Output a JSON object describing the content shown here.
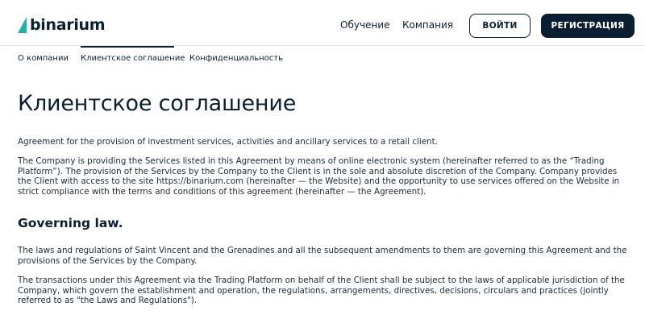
{
  "header": {
    "logo_text": "binarium",
    "nav": {
      "learn": "Обучение",
      "company": "Компания"
    },
    "login_label": "ВОЙТИ",
    "register_label": "РЕГИСТРАЦИЯ",
    "accent_color": "#1fb5a6",
    "dark_color": "#0b1f33"
  },
  "subnav": {
    "items": [
      {
        "label": "О компании",
        "active": false
      },
      {
        "label": "Клиентское соглашение",
        "active": true
      },
      {
        "label": "Конфиденциальность",
        "active": false
      }
    ]
  },
  "main": {
    "title": "Клиентское соглашение",
    "paragraphs": [
      "Agreement for the provision of investment services, activities and ancillary services to a retail client.",
      "The Company is providing the Services listed in this Agreement by means of online electronic system (hereinafter referred to as the “Trading Platform”). The provision of the Services by the Company to the Client is in the sole and absolute discretion of the Company. Company provides the Client with access to the site https://binarium.com (hereinafter — the Website) and the opportunity to use services offered on the Website in strict compliance with the terms and conditions of this agreement (hereinafter — the Agreement).",
      "The laws and regulations of Saint Vincent and the Grenadines and all the subsequent amendments to them are governing this Agreement and the provisions of the Services by the Company.",
      "The transactions under this Agreement via the Trading Platform on behalf of the Client shall be subject to the laws of applicable jurisdiction of the Company, which govern the establishment and operation, the regulations, arrangements, directives, decisions, circulars and practices (jointly referred to as \"the Laws and Regulations\")."
    ],
    "section_heading": "Governing law."
  }
}
